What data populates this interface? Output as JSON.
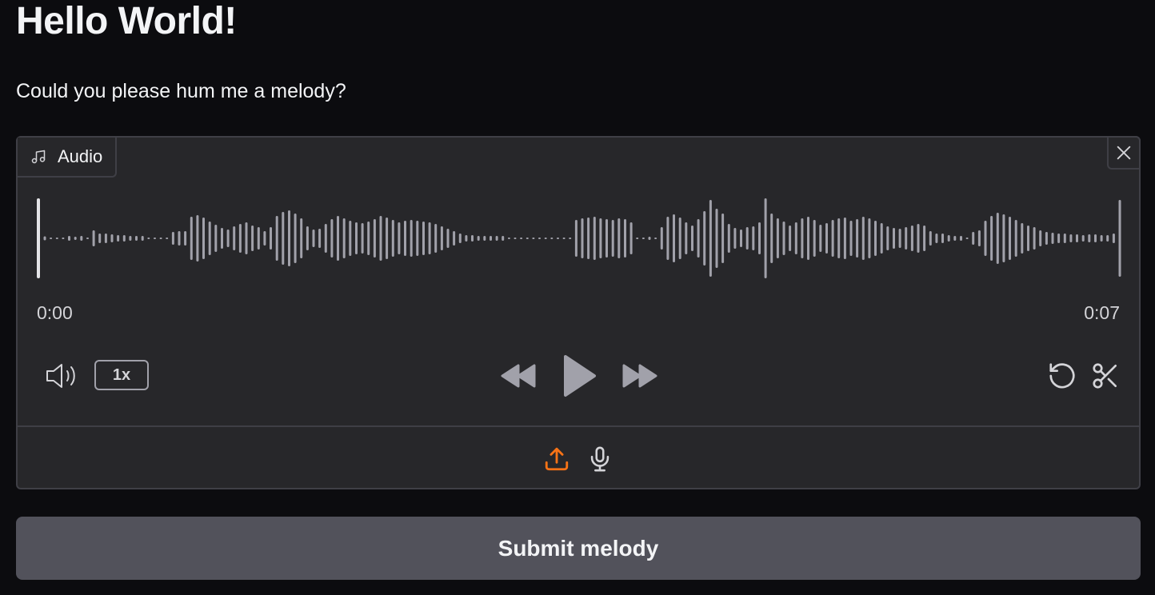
{
  "page": {
    "title": "Hello World!",
    "subtitle": "Could you please hum me a melody?"
  },
  "audio": {
    "label": "Audio",
    "label_icon": "music-note-icon",
    "close_icon": "close-icon",
    "time_start": "0:00",
    "time_end": "0:07",
    "playback_speed": "1x",
    "controls": {
      "volume_icon": "volume-icon",
      "rewind_icon": "rewind-icon",
      "play_icon": "play-icon",
      "forward_icon": "fast-forward-icon",
      "reset_icon": "reset-icon",
      "trim_icon": "scissors-icon"
    },
    "sources": {
      "upload_icon": "upload-icon",
      "microphone_icon": "microphone-icon"
    },
    "waveform_color": "#a1a1aa",
    "waveform": [
      0.05,
      0.02,
      0.02,
      0.02,
      0.06,
      0.04,
      0.06,
      0.02,
      0.2,
      0.12,
      0.12,
      0.1,
      0.08,
      0.08,
      0.06,
      0.06,
      0.06,
      0.02,
      0.02,
      0.02,
      0.02,
      0.16,
      0.18,
      0.18,
      0.54,
      0.58,
      0.52,
      0.42,
      0.34,
      0.26,
      0.22,
      0.3,
      0.36,
      0.4,
      0.32,
      0.28,
      0.18,
      0.28,
      0.56,
      0.66,
      0.7,
      0.62,
      0.5,
      0.3,
      0.22,
      0.24,
      0.36,
      0.48,
      0.56,
      0.5,
      0.44,
      0.4,
      0.38,
      0.42,
      0.48,
      0.56,
      0.52,
      0.46,
      0.4,
      0.44,
      0.46,
      0.44,
      0.42,
      0.4,
      0.36,
      0.3,
      0.24,
      0.18,
      0.12,
      0.08,
      0.08,
      0.06,
      0.06,
      0.06,
      0.06,
      0.06,
      0.02,
      0.02,
      0.02,
      0.02,
      0.02,
      0.02,
      0.02,
      0.02,
      0.02,
      0.02,
      0.02,
      0.46,
      0.5,
      0.52,
      0.54,
      0.5,
      0.48,
      0.46,
      0.5,
      0.48,
      0.4,
      0.02,
      0.02,
      0.04,
      0.02,
      0.28,
      0.54,
      0.6,
      0.52,
      0.4,
      0.32,
      0.48,
      0.68,
      0.96,
      0.74,
      0.62,
      0.36,
      0.26,
      0.22,
      0.28,
      0.3,
      0.4,
      1.0,
      0.62,
      0.5,
      0.42,
      0.32,
      0.4,
      0.5,
      0.54,
      0.46,
      0.34,
      0.38,
      0.46,
      0.5,
      0.52,
      0.44,
      0.48,
      0.54,
      0.5,
      0.44,
      0.38,
      0.3,
      0.26,
      0.24,
      0.28,
      0.32,
      0.36,
      0.32,
      0.18,
      0.12,
      0.12,
      0.08,
      0.06,
      0.06,
      0.02,
      0.16,
      0.2,
      0.44,
      0.56,
      0.64,
      0.6,
      0.54,
      0.46,
      0.38,
      0.32,
      0.28,
      0.2,
      0.16,
      0.14,
      0.12,
      0.12,
      0.1,
      0.1,
      0.08,
      0.1,
      0.1,
      0.08,
      0.08,
      0.12,
      0.96
    ]
  },
  "submit": {
    "label": "Submit melody"
  },
  "colors": {
    "background": "#0c0c0f",
    "panel": "#27272a",
    "border": "#3f3f46",
    "accent": "#f97316",
    "button": "#52525b",
    "icon": "#a1a1aa"
  }
}
